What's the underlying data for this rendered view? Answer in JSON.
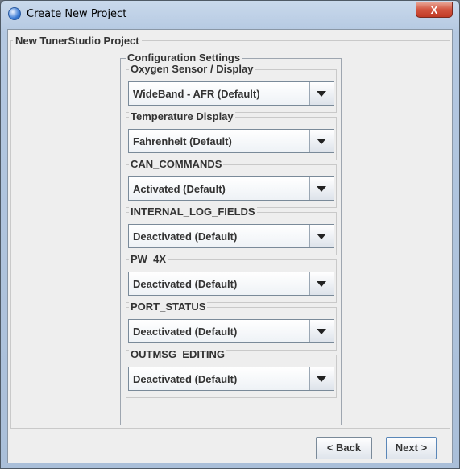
{
  "window": {
    "title": "Create New Project",
    "close_label": "X"
  },
  "project": {
    "legend": "New TunerStudio Project",
    "config": {
      "legend": "Configuration Settings",
      "groups": [
        {
          "label": "Oxygen Sensor / Display",
          "value": "WideBand - AFR (Default)"
        },
        {
          "label": "Temperature Display",
          "value": "Fahrenheit (Default)"
        },
        {
          "label": "CAN_COMMANDS",
          "value": "Activated (Default)"
        },
        {
          "label": "INTERNAL_LOG_FIELDS",
          "value": "Deactivated (Default)"
        },
        {
          "label": "PW_4X",
          "value": "Deactivated (Default)"
        },
        {
          "label": "PORT_STATUS",
          "value": "Deactivated (Default)"
        },
        {
          "label": "OUTMSG_EDITING",
          "value": "Deactivated (Default)"
        }
      ]
    }
  },
  "buttons": {
    "back": "< Back",
    "next": "Next >"
  }
}
